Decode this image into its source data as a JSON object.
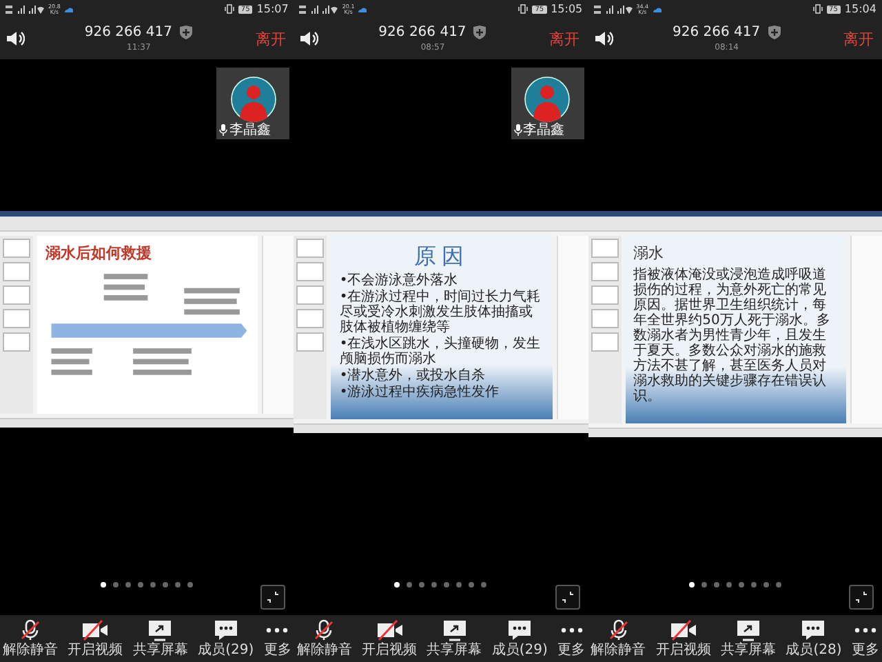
{
  "panels": [
    {
      "status_bar": {
        "net_speed": "20.8",
        "speed_unit": "K/s",
        "battery": "75",
        "time": "15:07"
      },
      "header": {
        "meeting_id": "926 266 417",
        "duration": "11:37",
        "leave_button": "离开"
      },
      "participant": {
        "name": "李晶鑫"
      },
      "shared_slide": {
        "kind": "diagram",
        "title": "溺水后如何救援"
      },
      "page_dots": [
        {
          "selected": true
        },
        {
          "selected": false
        },
        {
          "selected": false
        },
        {
          "selected": false
        },
        {
          "selected": false
        },
        {
          "selected": false
        },
        {
          "selected": false
        },
        {
          "selected": false
        }
      ],
      "toolbar": [
        {
          "kind": "mic-muted",
          "label": "解除静音"
        },
        {
          "kind": "video-off",
          "label": "开启视频"
        },
        {
          "kind": "share",
          "label": "共享屏幕"
        },
        {
          "kind": "members",
          "label": "成员(29)"
        },
        {
          "kind": "more",
          "label": "更多"
        }
      ]
    },
    {
      "status_bar": {
        "net_speed": "20.1",
        "speed_unit": "K/s",
        "battery": "75",
        "time": "15:05"
      },
      "header": {
        "meeting_id": "926 266 417",
        "duration": "08:57",
        "leave_button": "离开"
      },
      "participant": {
        "name": "李晶鑫"
      },
      "shared_slide": {
        "kind": "bullets",
        "title": "原因",
        "bullets": [
          "•不会游泳意外落水",
          "•在游泳过程中，时间过长力气耗尽或受冷水刺激发生肢体抽搐或肢体被植物缠绕等",
          "•在浅水区跳水，头撞硬物，发生颅脑损伤而溺水",
          "•潜水意外，或投水自杀",
          "•游泳过程中疾病急性发作"
        ]
      },
      "page_dots": [
        {
          "selected": true
        },
        {
          "selected": false
        },
        {
          "selected": false
        },
        {
          "selected": false
        },
        {
          "selected": false
        },
        {
          "selected": false
        },
        {
          "selected": false
        },
        {
          "selected": false
        }
      ],
      "toolbar": [
        {
          "kind": "mic-muted",
          "label": "解除静音"
        },
        {
          "kind": "video-off",
          "label": "开启视频"
        },
        {
          "kind": "share",
          "label": "共享屏幕"
        },
        {
          "kind": "members",
          "label": "成员(29)"
        },
        {
          "kind": "more",
          "label": "更多"
        }
      ]
    },
    {
      "status_bar": {
        "net_speed": "34.4",
        "speed_unit": "K/s",
        "battery": "75",
        "time": "15:04"
      },
      "header": {
        "meeting_id": "926 266 417",
        "duration": "08:14",
        "leave_button": "离开"
      },
      "shared_slide": {
        "kind": "paragraph",
        "title": "溺水",
        "text": "指被液体淹没或浸泡造成呼吸道损伤的过程，为意外死亡的常见原因。据世界卫生组织统计，每年全世界约50万人死于溺水。多数溺水者为男性青少年，且发生于夏天。多数公众对溺水的施救方法不甚了解，甚至医务人员对溺水救助的关键步骤存在错误认识。"
      },
      "page_dots": [
        {
          "selected": true
        },
        {
          "selected": false
        },
        {
          "selected": false
        },
        {
          "selected": false
        },
        {
          "selected": false
        },
        {
          "selected": false
        },
        {
          "selected": false
        },
        {
          "selected": false
        }
      ],
      "toolbar": [
        {
          "kind": "mic-muted",
          "label": "解除静音"
        },
        {
          "kind": "video-off",
          "label": "开启视频"
        },
        {
          "kind": "share",
          "label": "共享屏幕"
        },
        {
          "kind": "members",
          "label": "成员(28)"
        },
        {
          "kind": "more",
          "label": "更多"
        }
      ]
    }
  ]
}
